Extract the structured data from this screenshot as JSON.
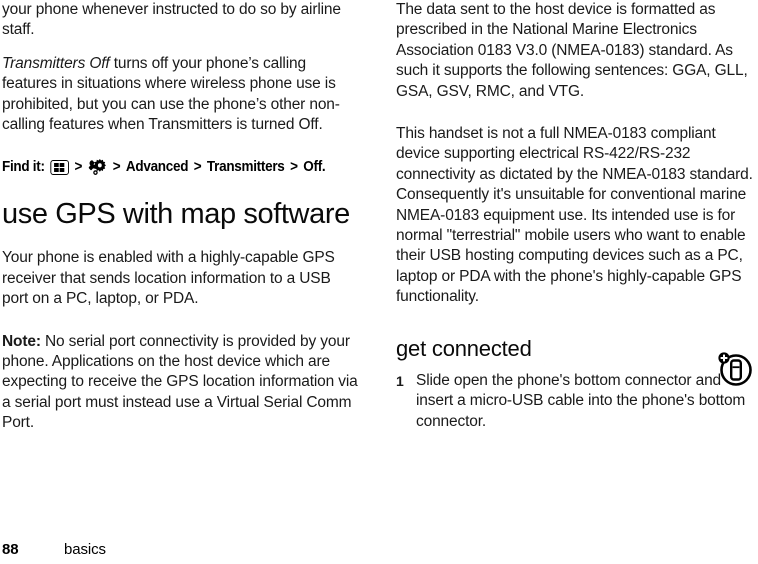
{
  "page": {
    "number": "88",
    "section": "basics"
  },
  "left_column": {
    "paragraphs": [
      {
        "id": "p-airline",
        "text": "your phone whenever instructed to do so by airline staff."
      },
      {
        "id": "p-transmitters",
        "italic_lead": "Transmitters Off",
        "text": " turns off your phone’s calling features in situations where wireless phone use is prohibited, but you can use the phone’s other non-calling features when Transmitters is turned Off."
      }
    ],
    "find_it": {
      "label": "Find it:",
      "separator": ">",
      "icon_menu_name": "main-menu-icon",
      "icon_settings_name": "settings-wrench-gear-icon",
      "step_advanced": "Advanced",
      "step_transmitters": "Transmitters",
      "step_off": "Off."
    },
    "heading": "use GPS with map software",
    "gps_paragraph": "Your phone is enabled with a highly-capable GPS receiver that sends location information to a USB port on a PC, laptop, or PDA.",
    "note": {
      "label": "Note:",
      "text": " No serial port connectivity is provided by your phone. Applications on the host device which are expecting to receive the GPS location information via a serial port must instead use a Virtual Serial Comm Port."
    }
  },
  "right_column": {
    "paragraphs": [
      {
        "id": "p-nmea-format",
        "text": "The data sent to the host device is formatted as prescribed in the National Marine Electronics Association 0183 V3.0 (NMEA-0183) standard. As such it supports the following sentences: GGA, GLL, GSA, GSV, RMC, and VTG."
      },
      {
        "id": "p-nmea-compliance",
        "text": "This handset is not a full NMEA-0183 compliant device supporting electrical RS-422/RS-232 connectivity as dictated by the NMEA-0183 standard. Consequently it's unsuitable for conventional marine NMEA-0183 equipment use. Its intended use is for normal \"terrestrial\" mobile users who want to enable their USB hosting computing devices such as a PC, laptop or PDA with the phone's highly-capable GPS functionality."
      }
    ],
    "heading": "get connected",
    "margin_icon_name": "phone-connect-icon",
    "steps": [
      {
        "number": "1",
        "text": "Slide open the phone's bottom connector and insert a micro-USB cable into the phone's bottom connector."
      }
    ]
  },
  "colors": {
    "text": "#1a1a1a",
    "background": "#ffffff",
    "icon": "#000000"
  }
}
